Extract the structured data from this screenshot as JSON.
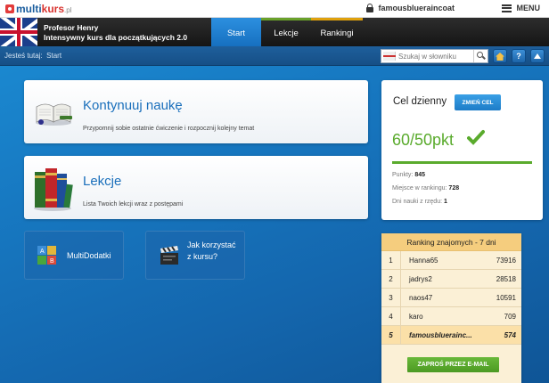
{
  "brand": {
    "name_multi": "multi",
    "name_kurs": "kurs",
    "tld": ".pl"
  },
  "user": {
    "name": "famousblueraincoat"
  },
  "menu": {
    "label": "MENU"
  },
  "course": {
    "teacher": "Profesor Henry",
    "title": "Intensywny kurs dla początkujących 2.0"
  },
  "tabs": [
    {
      "label": "Start",
      "active": true
    },
    {
      "label": "Lekcje",
      "active": false
    },
    {
      "label": "Rankingi",
      "active": false
    }
  ],
  "breadcrumb": {
    "prefix": "Jesteś tutaj:",
    "current": "Start"
  },
  "search": {
    "placeholder": "Szukaj w słowniku"
  },
  "toolbar_icons": [
    "home-icon",
    "help-icon",
    "scroll-top-icon"
  ],
  "cards": {
    "continue": {
      "title": "Kontynuuj naukę",
      "desc": "Przypomnij sobie ostatnie ćwiczenie i rozpocznij kolejny temat"
    },
    "lessons": {
      "title": "Lekcje",
      "desc": "Lista Twoich lekcji wraz z postępami"
    }
  },
  "tiles": {
    "extras": {
      "label": "MultiDodatki"
    },
    "howto": {
      "line1": "Jak korzystać",
      "line2": "z kursu?"
    }
  },
  "goal": {
    "title": "Cel dzienny",
    "change_label": "ZMIEŃ CEL",
    "score": "60/50pkt",
    "progress_fraction": 1.0,
    "points_label": "Punkty:",
    "points_value": "845",
    "rank_label": "Miejsce w rankingu:",
    "rank_value": "728",
    "streak_label": "Dni nauki z rzędu:",
    "streak_value": "1"
  },
  "ranking": {
    "title": "Ranking znajomych - 7 dni",
    "rows": [
      {
        "num": "1",
        "name": "Hanna65",
        "points": "73916"
      },
      {
        "num": "2",
        "name": "jadrys2",
        "points": "28518"
      },
      {
        "num": "3",
        "name": "naos47",
        "points": "10591"
      },
      {
        "num": "4",
        "name": "karo",
        "points": "709"
      },
      {
        "num": "5",
        "name": "famousblueraincoat...",
        "display_name": "famousbluerainc...",
        "points": "574"
      }
    ],
    "invite_label": "ZAPROŚ PRZEZ E-MAIL"
  },
  "colors": {
    "accent": "#1a6fbb",
    "success": "#5aab2d",
    "tab_lekcje": "#6aa12a",
    "tab_rankingi": "#e0a10d",
    "ranking_head": "#f5cd7e"
  }
}
